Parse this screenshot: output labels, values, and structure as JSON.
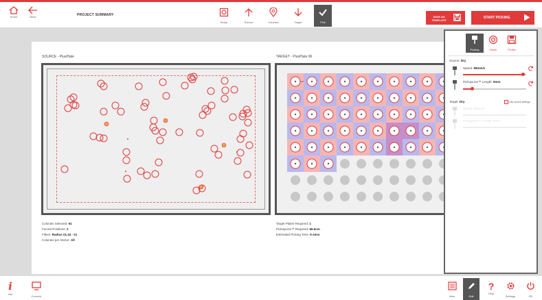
{
  "topbar": {
    "home_label": "Home",
    "back_label": "Back",
    "title": "PROJECT SUMMARY",
    "steps": [
      {
        "label": "Setup",
        "icon": "setup-icon",
        "active": false
      },
      {
        "label": "Source",
        "icon": "upload-icon",
        "active": false
      },
      {
        "label": "Colonies",
        "icon": "location-pin-icon",
        "active": false
      },
      {
        "label": "Target",
        "icon": "download-icon",
        "active": false
      },
      {
        "label": "Pick",
        "icon": "check-icon",
        "active": true
      }
    ],
    "save_template_label": "SAVE AS TEMPLATE",
    "start_picking_label": "START PICKING"
  },
  "source": {
    "label": "SOURCE - PlusPlate",
    "stats": [
      {
        "key": "Colonies Selected:",
        "value": "61"
      },
      {
        "key": "Forced Positions:",
        "value": "2"
      },
      {
        "key": "Filters:",
        "value": "Radius 01.44 - 21"
      },
      {
        "key": "Colonies per Sector:",
        "value": "All"
      }
    ]
  },
  "target": {
    "label": "TARGET - PlusPlate 96",
    "stats": [
      {
        "key": "Target Plates Required:",
        "value": "1"
      },
      {
        "key": "PickupLine™ Required:",
        "value": "66.6cm"
      },
      {
        "key": "Estimated Picking Time:",
        "value": "9 mins"
      }
    ],
    "wells_filled": 63,
    "wells_total": 96
  },
  "panel": {
    "tabs": [
      {
        "label": "Picking",
        "icon": "picking-icon",
        "active": true
      },
      {
        "label": "Wash",
        "icon": "wash-icon",
        "active": false
      },
      {
        "label": "Profile",
        "icon": "save-icon",
        "active": false
      }
    ],
    "source_label": "Source:",
    "source_value": "Dry",
    "speed_label": "Speed:",
    "speed_value": "99mm/s",
    "speed_level": 0.95,
    "pickup_label": "PickupLine™ Length:",
    "pickup_value": "9mm",
    "pickup_level": 0.15,
    "target_label": "Target:",
    "target_value": "Dry",
    "use_source_label": "Use source settings",
    "t_speed_label": "Speed: 99mm/s",
    "t_pickup_label": "PickupLine™ Length: 9mm"
  },
  "bottombar": {
    "info_label": "Info",
    "connect_label": "Connect",
    "view_label": "View",
    "edit_label": "Edit",
    "help_label": "Help",
    "settings_label": "Settings",
    "off_label": "Off"
  },
  "colors": {
    "accent": "#e03a3a",
    "orange": "#f0a050",
    "pink": "#f3b6b6",
    "blue": "#b9b9ee",
    "purple": "#c68fc9"
  }
}
